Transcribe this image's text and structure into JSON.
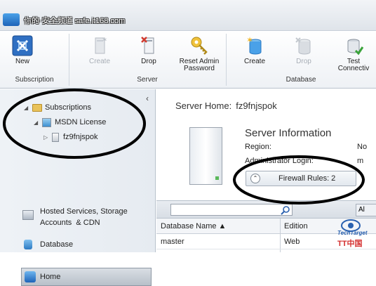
{
  "titlebar": {
    "watermark": "你的·安全频道 safe.it168.com"
  },
  "ribbon": {
    "buttons": [
      {
        "label": "New",
        "icon": "new-subscription-icon",
        "enabled": true
      },
      {
        "label": "Create",
        "icon": "create-server-icon",
        "enabled": false
      },
      {
        "label": "Drop",
        "icon": "drop-server-icon",
        "enabled": true
      },
      {
        "label": "Reset Admin\nPassword",
        "icon": "key-icon",
        "enabled": true
      },
      {
        "label": "Create",
        "icon": "create-database-icon",
        "enabled": true
      },
      {
        "label": "Drop",
        "icon": "drop-database-icon",
        "enabled": false
      },
      {
        "label": "Test\nConnectiv",
        "icon": "test-connectivity-icon",
        "enabled": true
      }
    ],
    "groups": {
      "subscription": "Subscription",
      "server": "Server",
      "database": "Database"
    }
  },
  "nav": {
    "collapse_icon": "‹",
    "tree": {
      "subscriptions": "Subscriptions",
      "msdn": "MSDN License",
      "server": "fz9fnjspok"
    },
    "home": "Home",
    "hosted": "Hosted Services, Storage\nAccounts  & CDN",
    "database": "Database"
  },
  "content": {
    "server_home_label": "Server Home:",
    "server_home_value": "fz9fnjspok",
    "info_title": "Server Information",
    "region_label": "Region:",
    "region_value": "No",
    "admin_label": "Administrator Login:",
    "admin_value": "m",
    "firewall_label": "Firewall Rules: 2"
  },
  "grid": {
    "search_placeholder": "",
    "all_button": "Al",
    "columns": [
      "Database Name ▲",
      "Edition"
    ],
    "rows": [
      {
        "name": "master",
        "edition": "Web"
      }
    ]
  },
  "watermark": {
    "techtarget": "TechTarget",
    "brand": "TT中国"
  },
  "colors": {
    "accent": "#1d63b8",
    "ribbon_bg": "#eef1f5",
    "nav_bg": "#e9eef4"
  }
}
